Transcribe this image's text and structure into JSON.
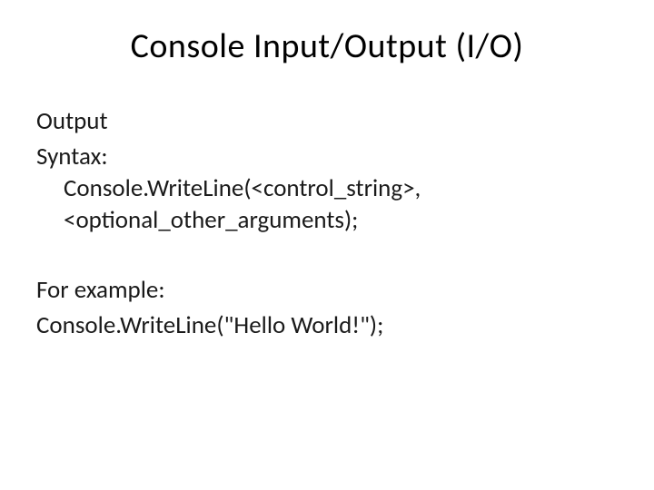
{
  "title": "Console Input/Output (I/O)",
  "body": {
    "output_label": "Output",
    "syntax_label": "Syntax:",
    "syntax_line": "Console.WriteLine(<control_string>,<optional_other_arguments);",
    "for_example_label": "For example:",
    "example_line": "Console.WriteLine(\"Hello World!\");"
  }
}
